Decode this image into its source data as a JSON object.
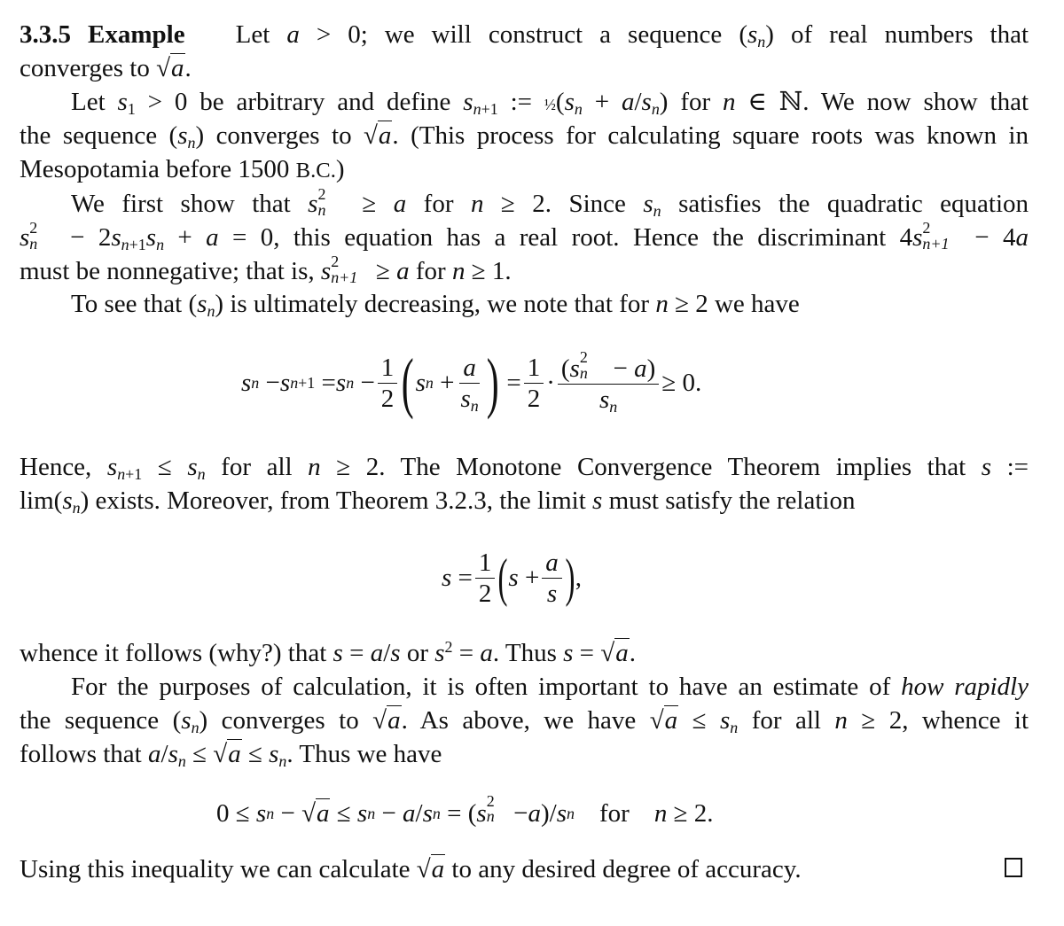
{
  "example": {
    "number": "3.3.5",
    "label": "Example",
    "heading": "3.3.5 Example",
    "para1": {
      "line1": "Let a > 0; we will construct a sequence (sₙ) of real numbers that",
      "line2": "converges to √a."
    },
    "para2": {
      "line1": "Let s₁ > 0 be arbitrary and define sₙ₊₁ := ½ (sₙ + a/sₙ) for n ∈ ℕ. We now show that",
      "line2": "the sequence (sₙ) converges to √a. (This process for calculating square roots was known in",
      "line3": "Mesopotamia before 1500 B.C.)"
    },
    "para3": {
      "line1": "We first show that sₙ² ≥ a for n ≥ 2. Since sₙ satisfies the quadratic equation",
      "line2": "sₙ² − 2sₙ₊₁sₙ + a = 0, this equation has a real root. Hence the discriminant 4sₙ₊₁² − 4a",
      "line3": "must be nonnegative; that is, sₙ₊₁² ≥ a for n ≥ 1."
    },
    "para4": {
      "line1": "To see that (sₙ) is ultimately decreasing, we note that for n ≥ 2 we have"
    },
    "equation1": "sₙ − sₙ₊₁ = sₙ − ½ (sₙ + a/sₙ) = ½ · (sₙ² − a)/sₙ ≥ 0.",
    "para5": {
      "line1": "Hence, sₙ₊₁ ≤ sₙ for all n ≥ 2. The Monotone Convergence Theorem implies that s :=",
      "line2": "lim(sₙ) exists. Moreover, from Theorem 3.2.3, the limit s must satisfy the relation"
    },
    "equation2": "s = ½ (s + a/s),",
    "para6": {
      "line1": "whence it follows (why?) that s = a/s or s² = a. Thus s = √a."
    },
    "para7": {
      "line1": "For the purposes of calculation, it is often important to have an estimate of how rapidly",
      "line2": "the sequence (sₙ) converges to √a. As above, we have √a ≤ sₙ for all n ≥ 2, whence it",
      "line3": "follows that a/sₙ ≤ √a ≤ sₙ. Thus we have"
    },
    "equation3": "0 ≤ sₙ − √a ≤ sₙ − a/sₙ = (sₙ² − a)/sₙ   for   n ≥ 2.",
    "para8": {
      "line1": "Using this inequality we can calculate √a to any desired degree of accuracy."
    },
    "qed_symbol": "□",
    "words": {
      "let": "Let",
      "we_will": "; we will construct a sequence",
      "of_real": "of real numbers that",
      "converges_to": "converges to",
      "be_arbitrary": "be arbitrary and define",
      "for": "for",
      "we_now_show": ". We now show that",
      "the_sequence": "the sequence",
      "this_process": ". (This process for calculating square roots was known in",
      "mesopotamia": "Mesopotamia before 1500",
      "bc": "B.C.",
      "we_first_show": "We first show that",
      "since": ". Since",
      "satisfies": "satisfies the quadratic equation",
      "this_equation": ", this equation has a real root. Hence the discriminant",
      "must_be": "must be nonnegative; that is,",
      "to_see": "To see that",
      "ultimately": "is ultimately decreasing, we note that for",
      "we_have": "we have",
      "hence": "Hence,",
      "for_all": "for all",
      "monotone": ". The Monotone Convergence Theorem implies that",
      "lim": "lim",
      "exists": "exists. Moreover, from Theorem 3.2.3, the limit",
      "must_satisfy": "must satisfy the relation",
      "whence": "whence it follows (why?) that",
      "or": "or",
      "thus": ". Thus",
      "for_the_purposes": "For the purposes of calculation, it is often important to have an estimate of",
      "how_rapidly": "how rapidly",
      "as_above": ". As above, we have",
      "whence_it": ", whence it",
      "follows_that": "follows that",
      "thus_we_have": ". Thus we have",
      "using": "Using this inequality we can calculate",
      "to_any": "to any desired degree of accuracy."
    }
  }
}
